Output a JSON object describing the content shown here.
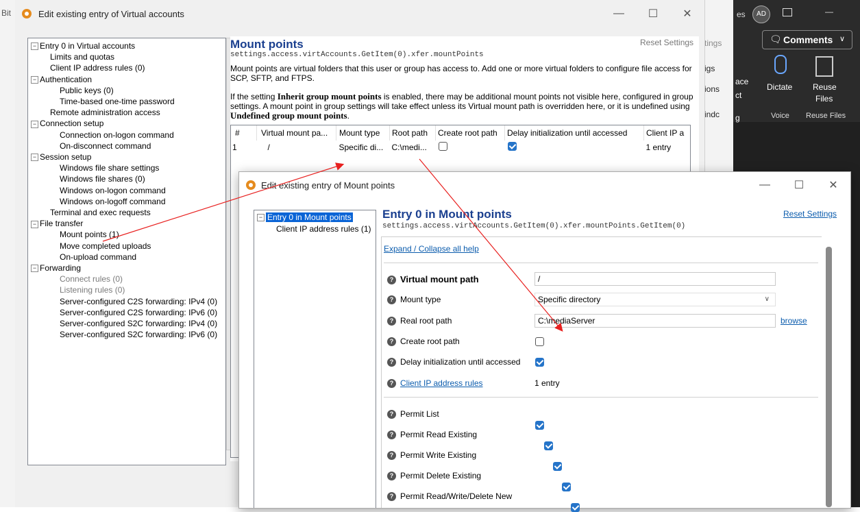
{
  "outer_window": {
    "title": "Edit existing entry of Virtual accounts",
    "minimize": "—",
    "maximize": "☐",
    "close": "✕"
  },
  "tree": [
    {
      "label": "Entry 0 in Virtual accounts",
      "level": 0,
      "expander": true
    },
    {
      "label": "Limits and quotas",
      "level": 1
    },
    {
      "label": "Client IP address rules (0)",
      "level": 1
    },
    {
      "label": "Authentication",
      "level": 0,
      "expander": true
    },
    {
      "label": "Public keys (0)",
      "level": 2
    },
    {
      "label": "Time-based one-time password",
      "level": 2
    },
    {
      "label": "Remote administration access",
      "level": 1
    },
    {
      "label": "Connection setup",
      "level": 0,
      "expander": true
    },
    {
      "label": "Connection on-logon command",
      "level": 2
    },
    {
      "label": "On-disconnect command",
      "level": 2
    },
    {
      "label": "Session setup",
      "level": 0,
      "expander": true
    },
    {
      "label": "Windows file share settings",
      "level": 2
    },
    {
      "label": "Windows file shares (0)",
      "level": 2
    },
    {
      "label": "Windows on-logon command",
      "level": 2
    },
    {
      "label": "Windows on-logoff command",
      "level": 2
    },
    {
      "label": "Terminal and exec requests",
      "level": 1
    },
    {
      "label": "File transfer",
      "level": 0,
      "expander": true
    },
    {
      "label": "Mount points (1)",
      "level": 2
    },
    {
      "label": "Move completed uploads",
      "level": 2
    },
    {
      "label": "On-upload command",
      "level": 2
    },
    {
      "label": "Forwarding",
      "level": 0,
      "expander": true
    },
    {
      "label": "Connect rules (0)",
      "level": 2,
      "muted": true
    },
    {
      "label": "Listening rules (0)",
      "level": 2,
      "muted": true
    },
    {
      "label": "Server-configured C2S forwarding: IPv4 (0)",
      "level": 2
    },
    {
      "label": "Server-configured C2S forwarding: IPv6 (0)",
      "level": 2
    },
    {
      "label": "Server-configured S2C forwarding: IPv4 (0)",
      "level": 2
    },
    {
      "label": "Server-configured S2C forwarding: IPv6 (0)",
      "level": 2
    }
  ],
  "mount_panel": {
    "title": "Mount points",
    "reset": "Reset Settings",
    "path": "settings.access.virtAccounts.GetItem(0).xfer.mountPoints",
    "desc1": "Mount points are virtual folders that this user or group has access to. Add one or more virtual folders to configure file access for SCP, SFTP, and FTPS.",
    "desc2_a": "If the setting ",
    "desc2_b": "Inherit group mount points",
    "desc2_c": " is enabled, there may be additional mount points not visible here, configured in group settings. A mount point in group settings will take effect unless its Virtual mount path is overridden here, or it is undefined using ",
    "desc2_d": "Undefined group mount points",
    "desc2_e": ".",
    "columns": [
      "#",
      "Virtual mount pa...",
      "Mount type",
      "Root path",
      "Create root path",
      "Delay initialization until accessed",
      "Client IP a"
    ],
    "row": {
      "num": "1",
      "vpath": "/",
      "type": "Specific di...",
      "root": "C:\\medi...",
      "ip": "1 entry"
    }
  },
  "inner_window": {
    "title": "Edit existing entry of Mount points",
    "minimize": "—",
    "maximize": "☐",
    "close": "✕",
    "tree_entry": "Entry 0 in Mount points",
    "tree_child": "Client IP address rules (1)",
    "heading": "Entry 0 in Mount points",
    "path": "settings.access.virtAccounts.GetItem(0).xfer.mountPoints.GetItem(0)",
    "reset": "Reset Settings",
    "expand": "Expand / Collapse all help",
    "fields": {
      "vpath_label": "Virtual mount path",
      "vpath_value": "/",
      "type_label": "Mount type",
      "type_value": "Specific directory",
      "root_label": "Real root path",
      "root_value": "C:\\mediaServer",
      "browse": "browse",
      "create_label": "Create root path",
      "delay_label": "Delay initialization until accessed",
      "ip_label": "Client IP address rules",
      "ip_value": "1 entry"
    },
    "permissions": [
      "Permit List",
      "Permit Read Existing",
      "Permit Write Existing",
      "Permit Delete Existing",
      "Permit Read/Write/Delete New"
    ],
    "help_glyph": "?"
  },
  "background": {
    "left_app_title": "Bit",
    "right_tab_1": "tings",
    "right_tab_2": "igs",
    "right_tab_3": "ions",
    "right_tab_4": "indc",
    "bg_text_1": "es",
    "avatar": "AD",
    "ribbon_comments": "Comments",
    "ribbon_ace": "ace",
    "ribbon_ct": "ct",
    "ribbon_g": "g",
    "dictate": "Dictate",
    "reuse": "Reuse",
    "files": "Files",
    "voice": "Voice",
    "reuse_files": "Reuse Files"
  }
}
